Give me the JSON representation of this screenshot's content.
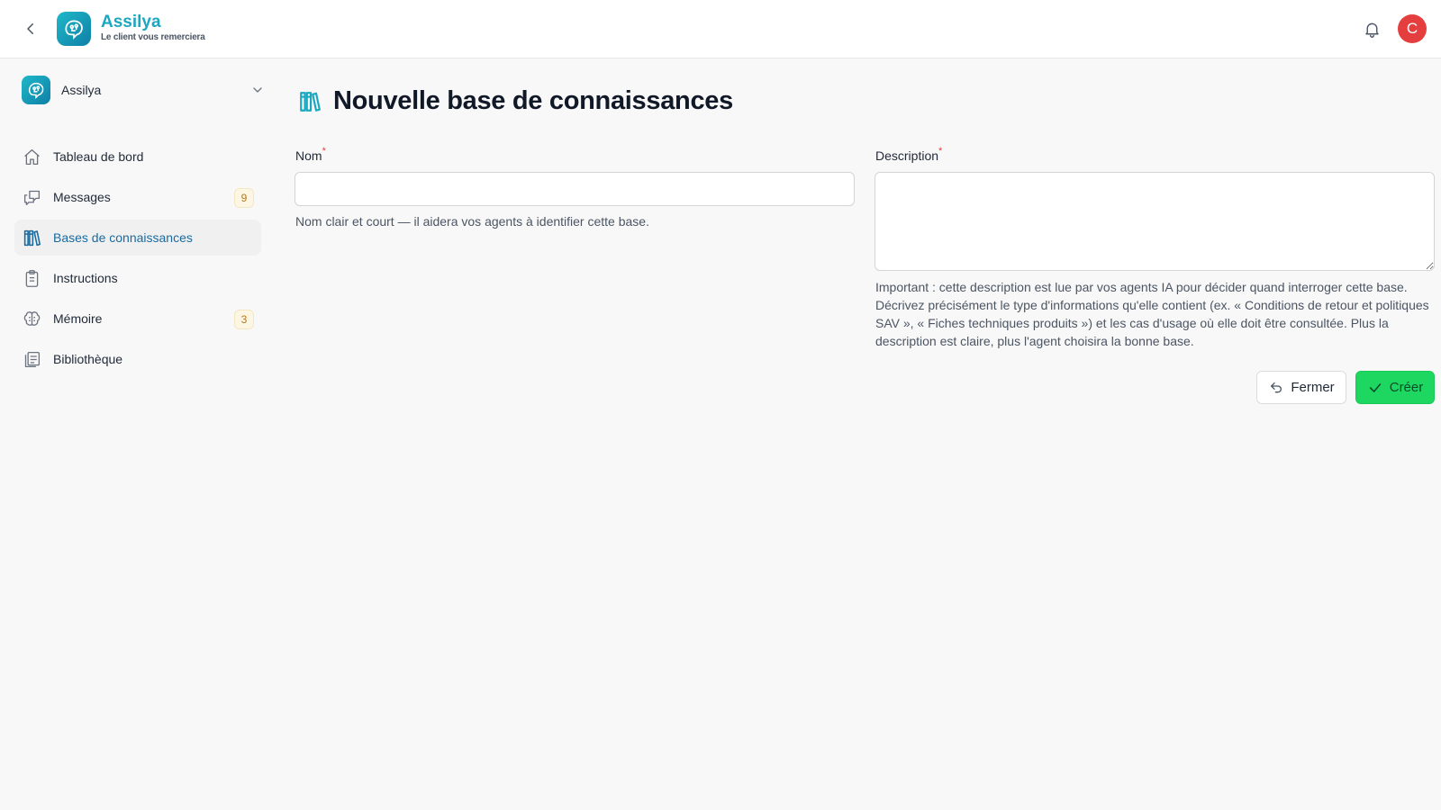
{
  "header": {
    "brand_name": "Assilya",
    "brand_tagline": "Le client vous remerciera",
    "avatar_initial": "C",
    "back_icon": "chevron-left-icon",
    "bell_icon": "bell-icon"
  },
  "sidebar": {
    "workspace_name": "Assilya",
    "items": [
      {
        "label": "Tableau de bord",
        "icon": "home-icon",
        "badge": ""
      },
      {
        "label": "Messages",
        "icon": "chat-bubbles-icon",
        "badge": "9"
      },
      {
        "label": "Bases de connaissances",
        "icon": "books-icon",
        "badge": "",
        "active": true
      },
      {
        "label": "Instructions",
        "icon": "clipboard-icon",
        "badge": ""
      },
      {
        "label": "Mémoire",
        "icon": "brain-icon",
        "badge": "3"
      },
      {
        "label": "Bibliothèque",
        "icon": "library-icon",
        "badge": ""
      }
    ]
  },
  "main": {
    "title": "Nouvelle base de connaissances",
    "name_field": {
      "label": "Nom",
      "required_mark": "*",
      "value": "",
      "help": "Nom clair et court — il aidera vos agents à identifier cette base."
    },
    "description_field": {
      "label": "Description",
      "required_mark": "*",
      "value": "",
      "help": "Important : cette description est lue par vos agents IA pour décider quand interroger cette base. Décrivez précisément le type d'informations qu'elle contient (ex. « Conditions de retour et politiques SAV », « Fiches techniques produits ») et les cas d'usage où elle doit être consultée. Plus la description est claire, plus l'agent choisira la bonne base."
    },
    "buttons": {
      "close_label": "Fermer",
      "create_label": "Créer"
    }
  },
  "colors": {
    "brand": "#1aa7c0",
    "active_nav": "#1a6aa0",
    "create_button": "#1ed760",
    "avatar": "#e53e3e",
    "badge_text": "#b7791f"
  }
}
